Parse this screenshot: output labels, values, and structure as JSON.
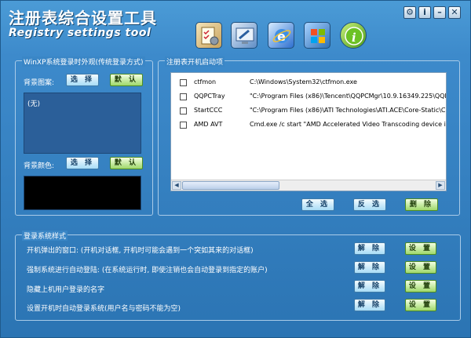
{
  "window": {
    "title_cn": "注册表综合设置工具",
    "title_en": "Registry settings tool",
    "controls": [
      "⚙",
      "i",
      "–",
      "✕"
    ]
  },
  "toolbar": {
    "icons": [
      "checklist-icon",
      "display-settings-icon",
      "ie-browser-icon",
      "windows-logo-icon",
      "info-icon"
    ]
  },
  "login_appearance": {
    "legend": "WinXP系统登录时外观(传统登录方式)",
    "bg_image_label": "背景图案:",
    "bg_image_value": "(无)",
    "bg_color_label": "背景颜色:",
    "select_label": "选 择",
    "default_label": "默 认"
  },
  "startup": {
    "legend": "注册表开机启动项",
    "rows": [
      {
        "name": "ctfmon",
        "command": "C:\\Windows\\System32\\ctfmon.exe"
      },
      {
        "name": "QQPCTray",
        "command": "\"C:\\Program Files (x86)\\Tencent\\QQPCMgr\\10.9.16349.225\\QQPCTR"
      },
      {
        "name": "StartCCC",
        "command": "\"C:\\Program Files (x86)\\ATI Technologies\\ATI.ACE\\Core-Static\\CLISta"
      },
      {
        "name": "AMD AVT",
        "command": "Cmd.exe /c start \"AMD Accelerated Video Transcoding device initializa"
      }
    ],
    "select_all": "全 选",
    "invert": "反 选",
    "delete": "删 除"
  },
  "login_style": {
    "legend": "登录系统样式",
    "rows": [
      {
        "label": "开机弹出的窗口: (开机对话框, 开机时可能会遇到一个突如其来的对话框)"
      },
      {
        "label": "强制系统进行自动登陆: (在系统运行时, 即使注销也会自动登录到指定的账户)"
      },
      {
        "label": "隐藏上机用户登录的名字"
      },
      {
        "label": "设置开机时自动登录系统(用户名与密码不能为空)"
      }
    ],
    "unlock_label": "解 除",
    "set_label": "设 置"
  }
}
